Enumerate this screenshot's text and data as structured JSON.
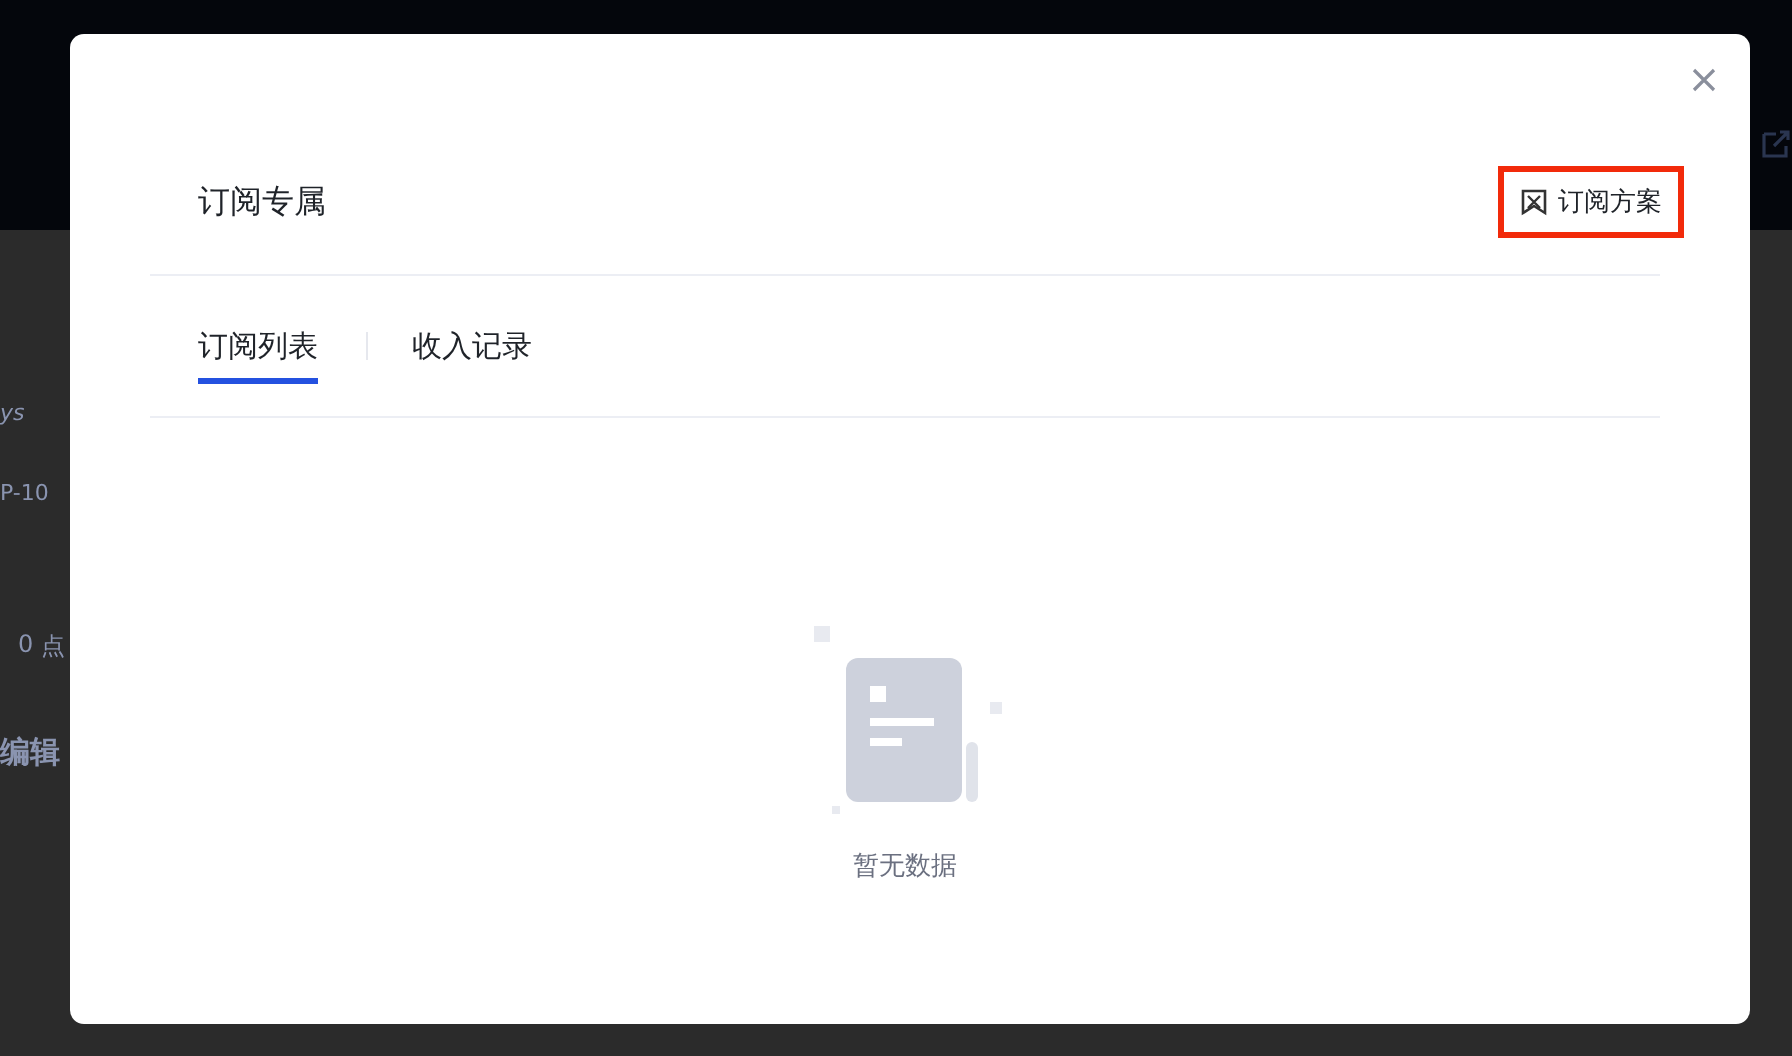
{
  "background": {
    "texts": [
      "ys",
      "P-10",
      "0",
      "点",
      "编辑"
    ]
  },
  "dialog": {
    "title": "订阅专属",
    "action": {
      "label": "订阅方案",
      "highlighted": true
    },
    "tabs": [
      {
        "label": "订阅列表",
        "selected": true
      },
      {
        "label": "收入记录",
        "selected": false
      }
    ],
    "empty_state": {
      "message": "暂无数据"
    }
  }
}
